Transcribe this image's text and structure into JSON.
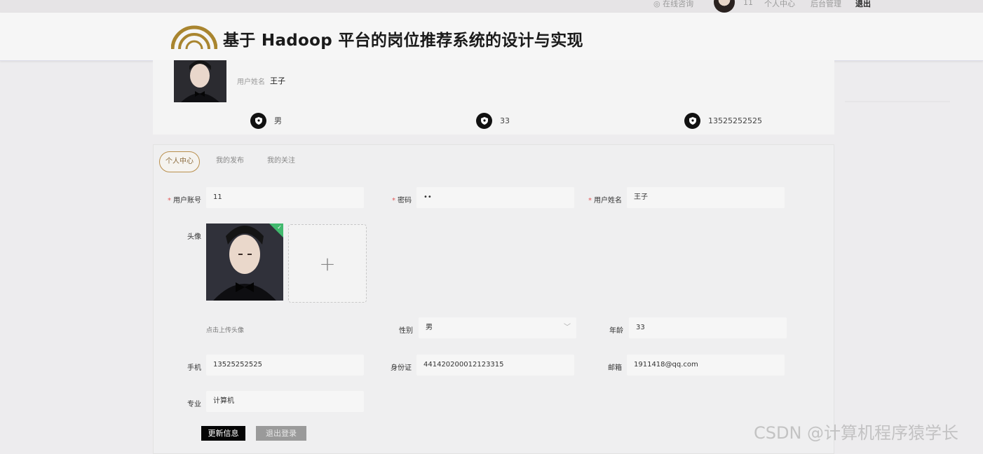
{
  "topbar": {
    "online_chat": "◎ 在线咨询",
    "username": "11",
    "personal_center": "个人中心",
    "admin": "后台管理",
    "logout": "退出"
  },
  "header": {
    "title": "基于 Hadoop 平台的岗位推荐系统的设计与实现"
  },
  "profile": {
    "name_label": "用户姓名",
    "name_value": "王子",
    "gender": "男",
    "age": "33",
    "phone": "13525252525"
  },
  "tabs": [
    {
      "label": "个人中心"
    },
    {
      "label": "我的发布"
    },
    {
      "label": "我的关注"
    }
  ],
  "form": {
    "account_label": "用户账号",
    "account_value": "11",
    "password_label": "密码",
    "password_value": "••",
    "name_label": "用户姓名",
    "name_value": "王子",
    "avatar_label": "头像",
    "upload_hint": "点击上传头像",
    "gender_label": "性别",
    "gender_value": "男",
    "age_label": "年龄",
    "age_value": "33",
    "phone_label": "手机",
    "phone_value": "13525252525",
    "idcard_label": "身份证",
    "idcard_value": "441420200012123315",
    "email_label": "邮箱",
    "email_value": "1911418@qq.com",
    "major_label": "专业",
    "major_value": "计算机",
    "required_mark": "*"
  },
  "buttons": {
    "update": "更新信息",
    "logout": "退出登录"
  },
  "watermark": "CSDN @计算机程序猿学长",
  "colors": {
    "accent_gold": "#b98f4d",
    "success_green": "#41b96e",
    "required_red": "#e25656"
  }
}
